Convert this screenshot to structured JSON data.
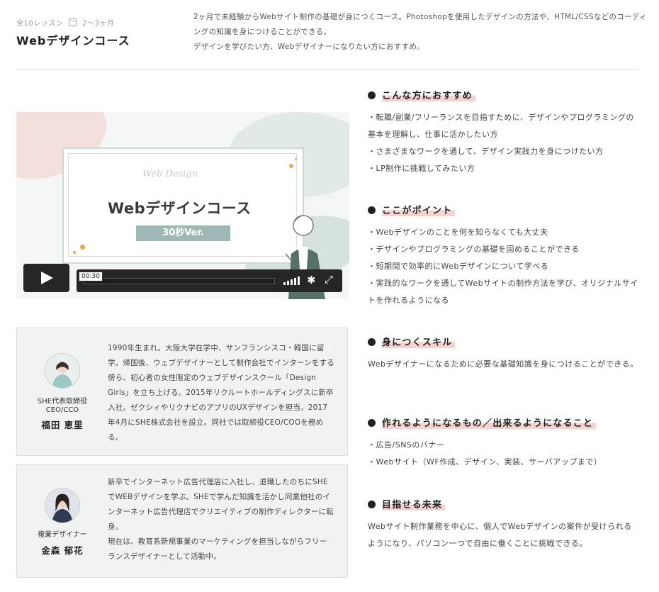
{
  "course": {
    "lessons": "全10レッスン",
    "duration": "2〜3ヶ月",
    "title": "Webデザインコース",
    "description": [
      "2ヶ月で未経験からWebサイト制作の基礎が身につくコース。Photoshopを使用したデザインの方法や、HTML/CSSなどのコーディングの知識を身につけることができる。",
      "デザインを学びたい方、Webデザイナーになりたい方におすすめ。"
    ]
  },
  "video": {
    "script_text": "Web Design",
    "title": "Webデザインコース",
    "badge": "30秒Ver.",
    "current_time": "00:30",
    "progress": 0,
    "icons": {
      "play": "play-icon",
      "volume": "volume-icon",
      "settings": "gear-icon",
      "fullscreen": "fullscreen-icon"
    }
  },
  "profiles": [
    {
      "role": "SHE代表取締役\nCEO/CCO",
      "name": "福田 恵里",
      "bio": "1990年生まれ。大阪大学在学中、サンフランシスコ・韓国に留学。帰国後、ウェブデザイナーとして制作会社でインターンをする傍ら、初心者の女性限定のウェブデザインスクール「Design Girls」を立ち上げる。2015年リクルートホールディングスに新卒入社。ゼクシィやリクナビのアプリのUXデザインを担当。2017年4月にSHE株式会社を設立。同社では取締役CEO/COOを務める。"
    },
    {
      "role": "複業デザイナー",
      "name": "金森 郁花",
      "bio": "新卒でインターネット広告代理店に入社し、退職したのちにSHEでWEBデザインを学ぶ。SHEで学んだ知識を活かし同業他社のインターネット広告代理店でクリエイティブの制作ディレクターに転身。\n現在は、教育系新規事業のマーケティングを担当しながらフリーランスデザイナーとして活動中。"
    }
  ],
  "sections": [
    {
      "title": "こんな方におすすめ",
      "items": [
        "・転職/副業/フリーランスを目指すために、デザインやプログラミングの基本を理解し、仕事に活かしたい方",
        "・さまざまなワークを通して、デザイン実践力を身につけたい方",
        "・LP制作に挑戦してみたい方"
      ]
    },
    {
      "title": "ここがポイント",
      "items": [
        "・Webデザインのことを何を知らなくても大丈夫",
        "・デザインやプログラミングの基礎を固めることができる",
        "・短期間で効率的にWebデザインについて学べる",
        "・実践的なワークを通してWebサイトの制作方法を学び、オリジナルサイトを作れるようになる"
      ]
    },
    {
      "title": "身につくスキル",
      "items": [
        "Webデザイナーになるために必要な基礎知識を身につけることができる。"
      ]
    },
    {
      "title": "作れるようになるもの／出来るようになること",
      "items": [
        "・広告/SNSのバナー",
        "・Webサイト（WF作成、デザイン、実装、サーバアップまで）"
      ]
    },
    {
      "title": "目指せる未来",
      "items": [
        "Webサイト制作業務を中心に、個人でWebデザインの案件が受けられるようになり、パソコン一つで自由に働くことに挑戦できる。"
      ]
    }
  ],
  "colors": {
    "highlight": "#f3d2d0",
    "panel": "#f1f3f3",
    "badge": "#9fb7b2",
    "player": "#262626"
  }
}
